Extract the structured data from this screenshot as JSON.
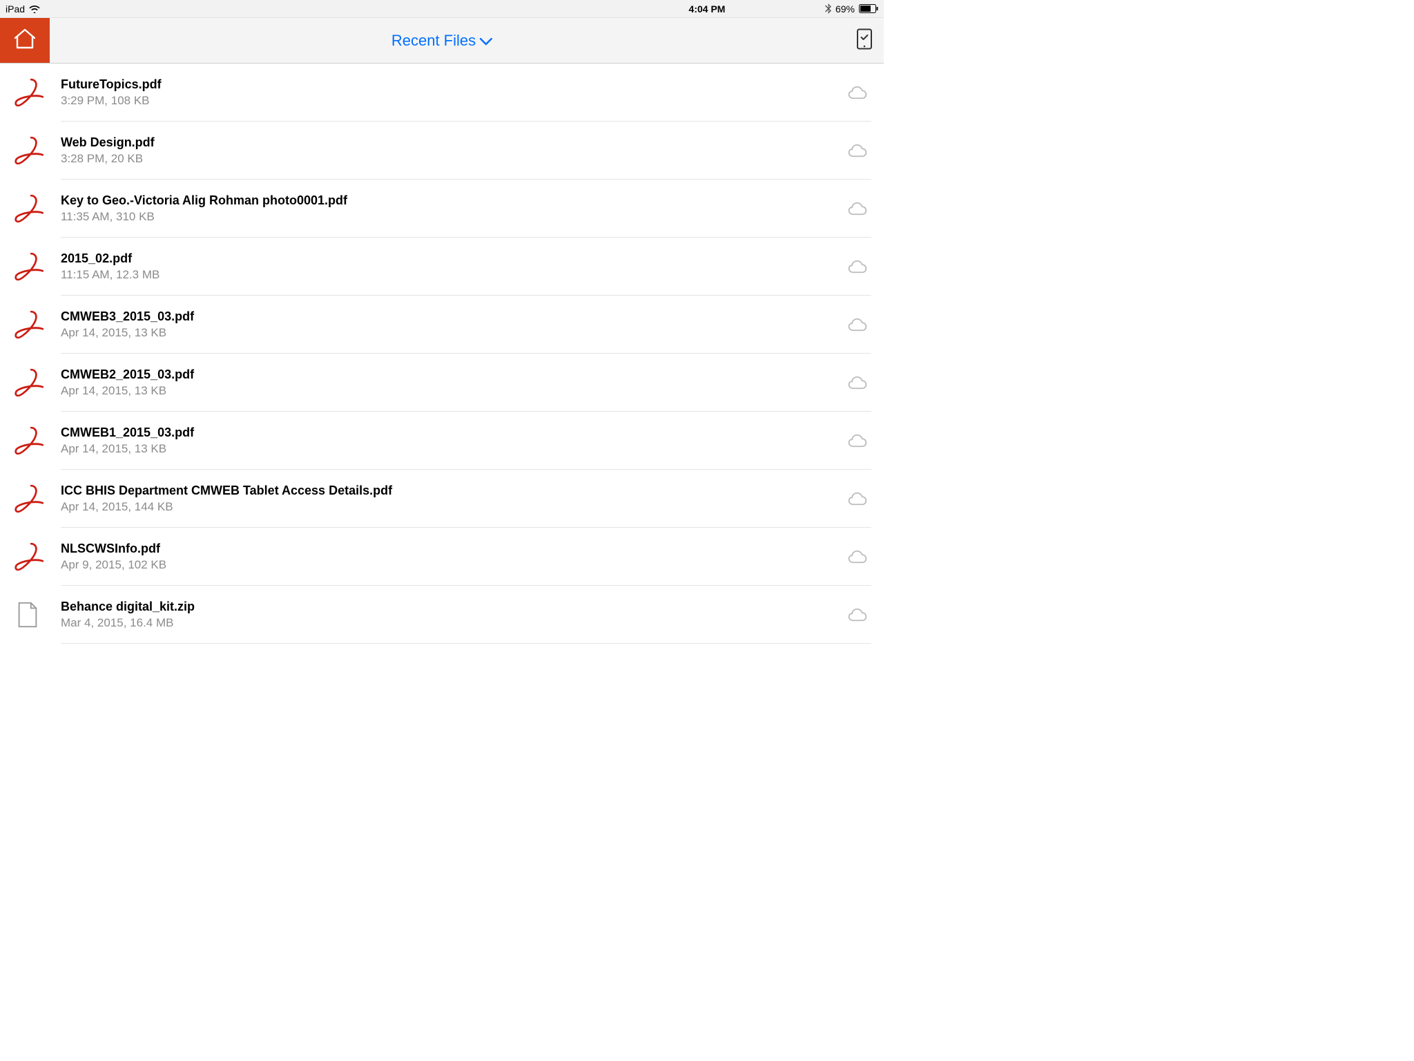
{
  "status_bar": {
    "carrier": "iPad",
    "time": "4:04 PM",
    "battery_pct": "69%"
  },
  "toolbar": {
    "title": "Recent Files"
  },
  "files": [
    {
      "icon": "pdf",
      "name": "FutureTopics.pdf",
      "meta": "3:29 PM, 108 KB"
    },
    {
      "icon": "pdf",
      "name": "Web Design.pdf",
      "meta": "3:28 PM, 20 KB"
    },
    {
      "icon": "pdf",
      "name": "Key to Geo.-Victoria Alig Rohman photo0001.pdf",
      "meta": "11:35 AM, 310 KB"
    },
    {
      "icon": "pdf",
      "name": "2015_02.pdf",
      "meta": "11:15 AM, 12.3 MB"
    },
    {
      "icon": "pdf",
      "name": "CMWEB3_2015_03.pdf",
      "meta": "Apr 14, 2015, 13 KB"
    },
    {
      "icon": "pdf",
      "name": "CMWEB2_2015_03.pdf",
      "meta": "Apr 14, 2015, 13 KB"
    },
    {
      "icon": "pdf",
      "name": "CMWEB1_2015_03.pdf",
      "meta": "Apr 14, 2015, 13 KB"
    },
    {
      "icon": "pdf",
      "name": "ICC BHIS Department CMWEB Tablet Access Details.pdf",
      "meta": "Apr 14, 2015, 144 KB"
    },
    {
      "icon": "pdf",
      "name": "NLSCWSInfo.pdf",
      "meta": "Apr 9, 2015, 102 KB"
    },
    {
      "icon": "zip",
      "name": "Behance digital_kit.zip",
      "meta": "Mar 4, 2015, 16.4 MB"
    }
  ]
}
